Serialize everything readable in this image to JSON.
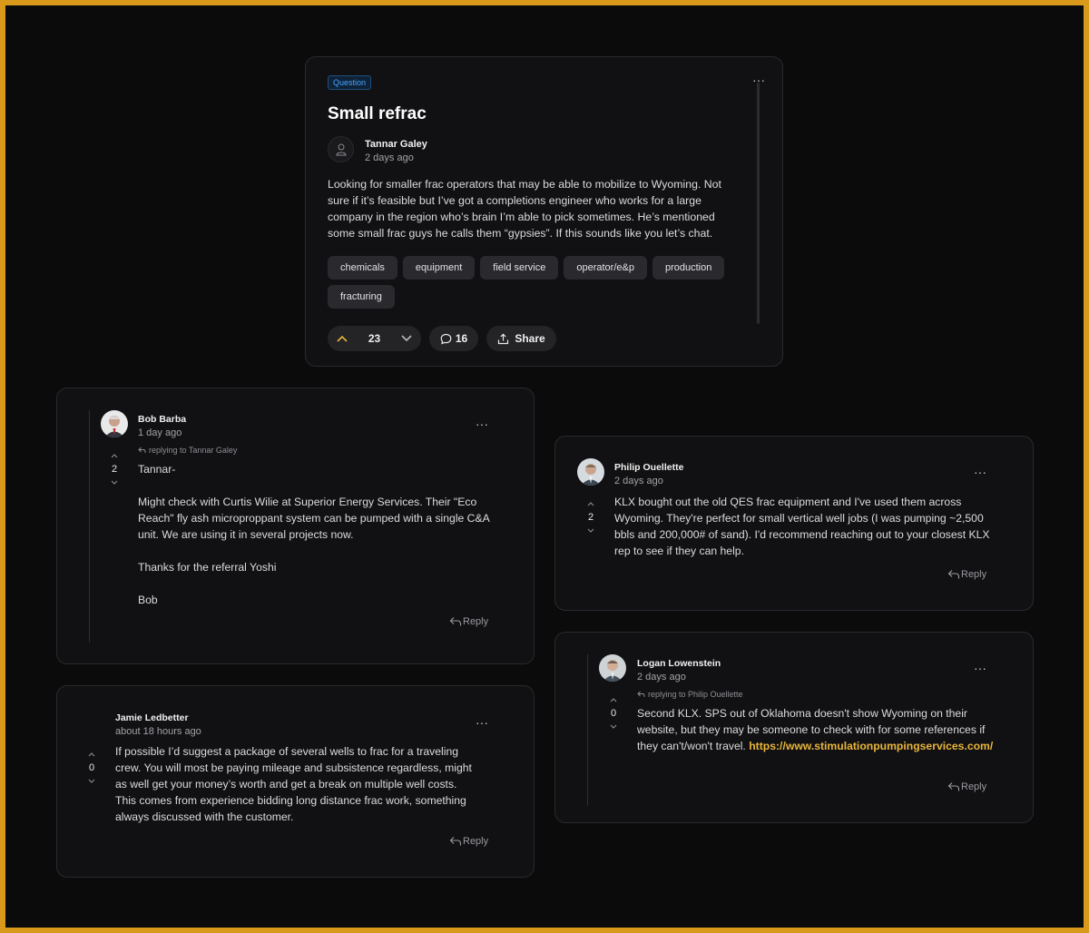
{
  "post": {
    "badge": "Question",
    "title": "Small refrac",
    "author": "Tannar Galey",
    "time": "2 days ago",
    "body": "Looking for smaller frac operators that may be able to mobilize to Wyoming.  Not sure if it’s feasible but I’ve got a completions engineer who works for a large company in the region who’s brain I’m able to pick sometimes. He’s mentioned some small frac guys he calls them “gypsies”. If this sounds like you let’s chat.",
    "tags": [
      "chemicals",
      "equipment",
      "field service",
      "operator/e&p",
      "production",
      "fracturing"
    ],
    "votes": "23",
    "comments": "16",
    "share_label": "Share",
    "menu": "···"
  },
  "comments": {
    "bob": {
      "name": "Bob Barba",
      "time": "1 day ago",
      "replying": "replying to Tannar Galey",
      "votes": "2",
      "body": [
        "Tannar-",
        "",
        "Might check with Curtis Wilie at Superior Energy Services. Their \"Eco Reach\" fly ash microproppant system can be pumped with a single C&A unit.  We are using it in several projects now.",
        "",
        "Thanks for the referral Yoshi",
        "",
        "Bob"
      ],
      "reply_label": "Reply",
      "menu": "···"
    },
    "jamie": {
      "name": "Jamie Ledbetter",
      "time": "about 18 hours ago",
      "votes": "0",
      "body": "If possible I’d suggest a package of several wells to frac for a traveling crew. You will most be paying mileage and subsistence regardless, might as well get your money’s worth and get a break on multiple well costs. This comes from experience bidding long distance frac work, something always discussed with the customer.",
      "reply_label": "Reply",
      "menu": "···"
    },
    "philip": {
      "name": "Philip Ouellette",
      "time": "2 days ago",
      "votes": "2",
      "body": "KLX bought out the old QES frac equipment and I've used them across Wyoming. They're perfect for small vertical well jobs (I was pumping ~2,500 bbls and 200,000# of sand). I'd recommend reaching out to your closest KLX rep to see if they can help.",
      "reply_label": "Reply",
      "menu": "···"
    },
    "logan": {
      "name": "Logan Lowenstein",
      "time": "2 days ago",
      "replying": "replying to Philip Ouellette",
      "votes": "0",
      "body": "Second KLX. SPS out of Oklahoma doesn't show Wyoming on their website, but they may be someone to check with for some references if they can't/won't travel.",
      "link": "https://www.stimulationpumpingservices.com/",
      "reply_label": "Reply",
      "menu": "···"
    }
  },
  "colors": {
    "accent": "#e8b53b",
    "frame": "#d99a1c",
    "badge": "#4aa3ff",
    "background": "#0b0b0c",
    "card": "#111113"
  }
}
